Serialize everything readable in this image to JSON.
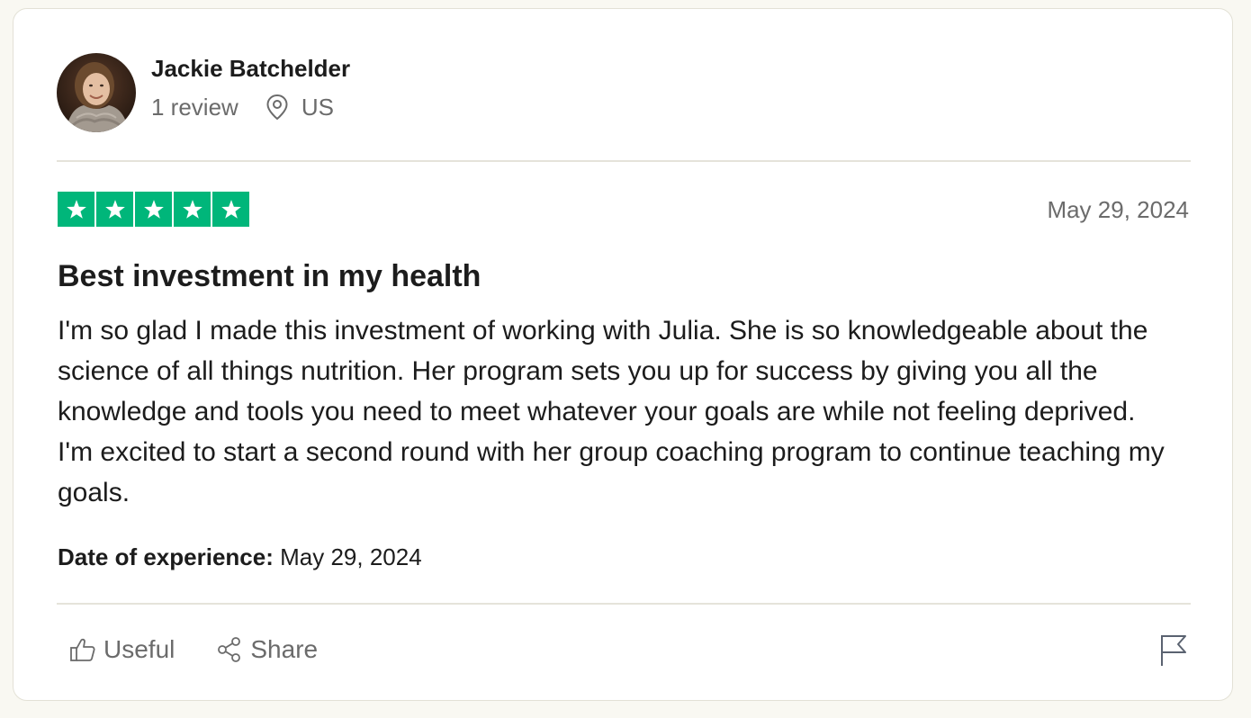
{
  "reviewer": {
    "name": "Jackie Batchelder",
    "review_count": "1 review",
    "country": "US"
  },
  "review": {
    "rating": 5,
    "rating_max": 5,
    "date": "May 29, 2024",
    "title": "Best investment in my health",
    "body": "I'm so glad I made this investment of working with Julia. She is so knowledgeable about the science of all things nutrition. Her program sets you up for success by giving you all the knowledge and tools you need to meet whatever your goals are while not feeling deprived. I'm excited to start a second round with her group coaching program to continue teaching my goals.",
    "experience_label": "Date of experience:",
    "experience_date": "May 29, 2024"
  },
  "actions": {
    "useful_label": "Useful",
    "share_label": "Share"
  },
  "icons": {
    "location": "location-pin-icon",
    "useful": "thumbs-up-icon",
    "share": "share-icon",
    "report": "flag-icon"
  },
  "colors": {
    "star_green": "#00b67a",
    "page_background": "#f9f8f2",
    "muted_text": "#6b6b6b"
  }
}
